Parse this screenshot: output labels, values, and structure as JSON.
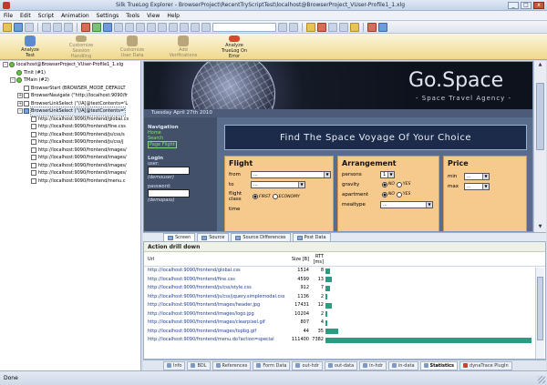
{
  "window": {
    "title": "Silk TrueLog Explorer - BrowserProject\\RecentTryScriptTest\\localhost@BrowserProject_VUser-Profile1_1.xlg",
    "controls": [
      "_",
      "□",
      "x"
    ]
  },
  "menu": [
    "File",
    "Edit",
    "Script",
    "Animation",
    "Settings",
    "Tools",
    "View",
    "Help"
  ],
  "ribbon": [
    {
      "label": "Analyze\nTest",
      "icon": "magnifier-icon",
      "enabled": true
    },
    {
      "label": "Customize\nSession Handling",
      "icon": "puzzle-icon",
      "enabled": false
    },
    {
      "label": "Customize\nUser Data",
      "icon": "users-icon",
      "enabled": false
    },
    {
      "label": "Add\nVerifications",
      "icon": "checklist-icon",
      "enabled": false
    },
    {
      "label": "Analyze\nTrueLog On Error",
      "icon": "lightning-icon",
      "enabled": true
    }
  ],
  "tree": [
    {
      "label": "localhost@BrowserProject_VUser-Profile1_1.xlg",
      "indent": 0,
      "exp": "-",
      "icon": "green"
    },
    {
      "label": "TInit (#1)",
      "indent": 1,
      "exp": "",
      "icon": "green"
    },
    {
      "label": "TMain (#2)",
      "indent": 1,
      "exp": "-",
      "icon": "green"
    },
    {
      "label": "BrowserStart (BROWSER_MODE_DEFAULT",
      "indent": 2,
      "exp": "",
      "icon": "page"
    },
    {
      "label": "BrowserNavigate (\"http://localhost:9090/fr",
      "indent": 2,
      "exp": "+",
      "icon": "page"
    },
    {
      "label": "BrowserLinkSelect (\"//A[@textContents='L",
      "indent": 2,
      "exp": "+",
      "icon": "page"
    },
    {
      "label": "BrowserLinkSelect (\"//A[@textContents='",
      "indent": 2,
      "exp": "-",
      "icon": "sel",
      "selected": true
    },
    {
      "label": "http://localhost:9090/frontend/global.cs",
      "indent": 3,
      "exp": "",
      "icon": "page"
    },
    {
      "label": "http://localhost:9090/frontend/fine.css",
      "indent": 3,
      "exp": "",
      "icon": "page"
    },
    {
      "label": "http://localhost:9090/frontend/js/css/s",
      "indent": 3,
      "exp": "",
      "icon": "page"
    },
    {
      "label": "http://localhost:9090/frontend/js/css/j",
      "indent": 3,
      "exp": "",
      "icon": "page"
    },
    {
      "label": "http://localhost:9090/frontend/images/",
      "indent": 3,
      "exp": "",
      "icon": "page"
    },
    {
      "label": "http://localhost:9090/frontend/images/",
      "indent": 3,
      "exp": "",
      "icon": "page"
    },
    {
      "label": "http://localhost:9090/frontend/images/",
      "indent": 3,
      "exp": "",
      "icon": "page"
    },
    {
      "label": "http://localhost:9090/frontend/images/",
      "indent": 3,
      "exp": "",
      "icon": "page"
    },
    {
      "label": "http://localhost:9090/frontend/menu.c",
      "indent": 3,
      "exp": "",
      "icon": "page"
    }
  ],
  "site": {
    "brand": "Go.Space",
    "tagline": "- Space Travel Agency -",
    "date": "Tuesday April 27th 2010",
    "nav_heading": "Navigation",
    "nav_links": [
      "Home",
      "Search",
      "Page Flight"
    ],
    "login_heading": "Login",
    "user_label": "user:",
    "user_hint": "(demouser)",
    "password_label": "password:",
    "password_hint": "(demopass)",
    "find_heading": "Find The Space Voyage Of Your Choice",
    "flight": {
      "title": "Flight",
      "from_label": "from",
      "from_value": "...",
      "to_label": "to",
      "to_value": "...",
      "class_label": "flight class",
      "class_options": [
        "FIRST",
        "ECONOMY"
      ],
      "time_label": "time"
    },
    "arrangement": {
      "title": "Arrangement",
      "persons_label": "persons",
      "persons_value": "1",
      "gravity_label": "gravity",
      "apartment_label": "apartment",
      "radio_options": [
        "NO",
        "YES"
      ],
      "mealtype_label": "mealtype",
      "mealtype_value": "..."
    },
    "price": {
      "title": "Price",
      "min_label": "min",
      "min_value": "...",
      "max_label": "max",
      "max_value": "..."
    }
  },
  "view_tabs": [
    {
      "label": "Screen",
      "active": true
    },
    {
      "label": "Source",
      "active": false
    },
    {
      "label": "Source Differences",
      "active": false
    },
    {
      "label": "Post Data",
      "active": false
    }
  ],
  "drill": {
    "title": "Action drill down",
    "col_url": "Url",
    "col_size": "Size [B]",
    "col_rtt": "RTT [ms]",
    "rows": [
      {
        "url": "http://localhost:9090/frontend/global.css",
        "size": "1514",
        "rtt": "8",
        "bar": 0.02
      },
      {
        "url": "http://localhost:9090/frontend/fine.css",
        "size": "4599",
        "rtt": "13",
        "bar": 0.03
      },
      {
        "url": "http://localhost:9090/frontend/js/css/style.css",
        "size": "912",
        "rtt": "7",
        "bar": 0.02
      },
      {
        "url": "http://localhost:9090/frontend/js/css/jquery.simplemodal.css",
        "size": "1136",
        "rtt": "2",
        "bar": 0.01
      },
      {
        "url": "http://localhost:9090/frontend/images/header.jpg",
        "size": "17431",
        "rtt": "12",
        "bar": 0.03
      },
      {
        "url": "http://localhost:9090/frontend/images/logo.jpg",
        "size": "10204",
        "rtt": "2",
        "bar": 0.01
      },
      {
        "url": "http://localhost:9090/frontend/images/clearpixel.gif",
        "size": "807",
        "rtt": "4",
        "bar": 0.01
      },
      {
        "url": "http://localhost:9090/frontend/images/topbg.gif",
        "size": "44",
        "rtt": "35",
        "bar": 0.06
      },
      {
        "url": "http://localhost:9090/frontend/menu.do?action=special",
        "size": "111400",
        "rtt": "7382",
        "bar": 1.0
      }
    ]
  },
  "bottom_tabs": [
    {
      "label": "Info",
      "active": false
    },
    {
      "label": "BDL",
      "active": false
    },
    {
      "label": "References",
      "active": false
    },
    {
      "label": "Form Data",
      "active": false
    },
    {
      "label": "out-hdr",
      "active": false
    },
    {
      "label": "out-data",
      "active": false
    },
    {
      "label": "in-hdr",
      "active": false
    },
    {
      "label": "in-data",
      "active": false
    },
    {
      "label": "Statistics",
      "active": true
    },
    {
      "label": "dynaTrace PlugIn",
      "active": false
    }
  ],
  "status": "Done",
  "colors": {
    "ribbon": "#f0d98c",
    "header_dark": "#151a27",
    "nav_panel": "#43506a",
    "find_box": "#1d2b4a",
    "card": "#f6c98d",
    "bar": "#2a9c82",
    "nav_link": "#7fe36d"
  }
}
